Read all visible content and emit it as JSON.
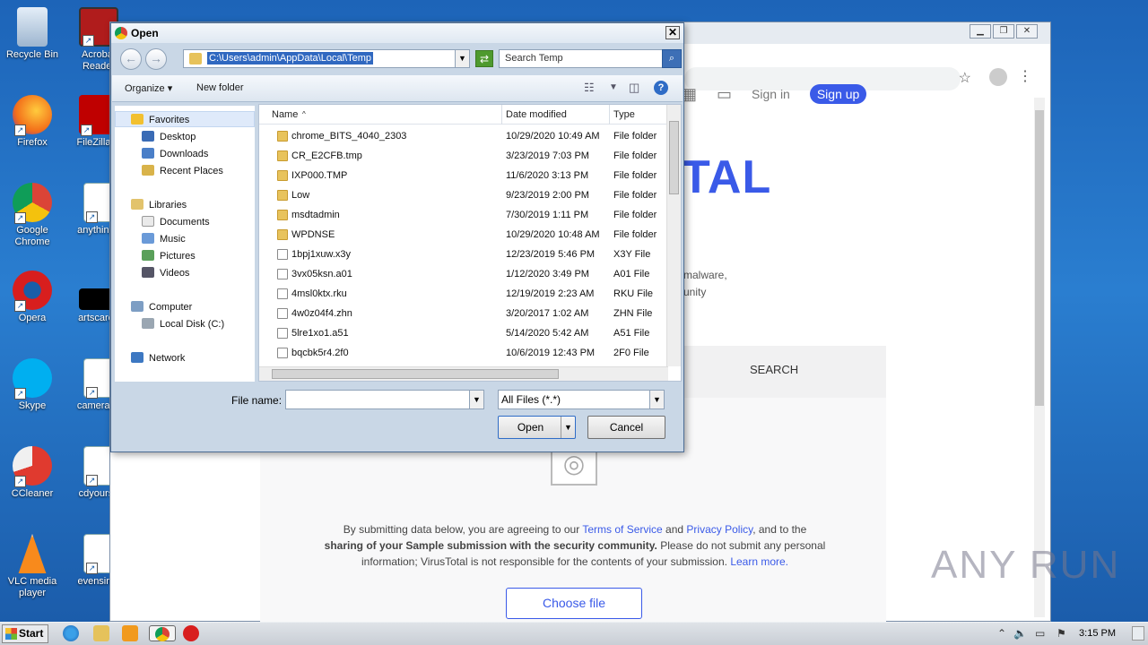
{
  "desktop": {
    "icons": [
      {
        "label": "Recycle Bin"
      },
      {
        "label": "Acrobat Reader"
      },
      {
        "label": "Firefox"
      },
      {
        "label": "FileZilla C"
      },
      {
        "label": "Google Chrome"
      },
      {
        "label": "anythingh"
      },
      {
        "label": "Opera"
      },
      {
        "label": "artscaree"
      },
      {
        "label": "Skype"
      },
      {
        "label": "cameraca"
      },
      {
        "label": "CCleaner"
      },
      {
        "label": "cdyourse"
      },
      {
        "label": "VLC media player"
      },
      {
        "label": "evensimp"
      }
    ]
  },
  "browser": {
    "header": {
      "signin": "Sign in",
      "signup": "Sign up"
    },
    "logo_fragment": "TAL",
    "sub1": "malware,",
    "sub2": "unity",
    "tab_search": "SEARCH",
    "notice": {
      "p1": "By submitting data below, you are agreeing to our ",
      "terms": "Terms of Service",
      "and": " and ",
      "privacy": "Privacy Policy",
      "p2": ", and to the",
      "bold": "sharing of your Sample submission with the security community.",
      "p3": " Please do not submit any personal information; VirusTotal is not responsible for the contents of your submission. ",
      "learn": "Learn more."
    },
    "choose_file": "Choose file"
  },
  "dialog": {
    "title": "Open",
    "address": "C:\\Users\\admin\\AppData\\Local\\Temp",
    "search_placeholder": "Search Temp",
    "organize": "Organize",
    "new_folder": "New folder",
    "nav": {
      "favorites": "Favorites",
      "desktop": "Desktop",
      "downloads": "Downloads",
      "recent": "Recent Places",
      "libraries": "Libraries",
      "documents": "Documents",
      "music": "Music",
      "pictures": "Pictures",
      "videos": "Videos",
      "computer": "Computer",
      "local_disk": "Local Disk (C:)",
      "network": "Network"
    },
    "columns": {
      "name": "Name",
      "date": "Date modified",
      "type": "Type"
    },
    "files": [
      {
        "name": "chrome_BITS_4040_2303",
        "date": "10/29/2020 10:49 AM",
        "type": "File folder",
        "kind": "folder"
      },
      {
        "name": "CR_E2CFB.tmp",
        "date": "3/23/2019 7:03 PM",
        "type": "File folder",
        "kind": "folder"
      },
      {
        "name": "IXP000.TMP",
        "date": "11/6/2020 3:13 PM",
        "type": "File folder",
        "kind": "folder"
      },
      {
        "name": "Low",
        "date": "9/23/2019 2:00 PM",
        "type": "File folder",
        "kind": "folder"
      },
      {
        "name": "msdtadmin",
        "date": "7/30/2019 1:11 PM",
        "type": "File folder",
        "kind": "folder"
      },
      {
        "name": "WPDNSE",
        "date": "10/29/2020 10:48 AM",
        "type": "File folder",
        "kind": "folder"
      },
      {
        "name": "1bpj1xuw.x3y",
        "date": "12/23/2019 5:46 PM",
        "type": "X3Y File",
        "kind": "file"
      },
      {
        "name": "3vx05ksn.a01",
        "date": "1/12/2020 3:49 PM",
        "type": "A01 File",
        "kind": "file"
      },
      {
        "name": "4msl0ktx.rku",
        "date": "12/19/2019 2:23 AM",
        "type": "RKU File",
        "kind": "file"
      },
      {
        "name": "4w0z04f4.zhn",
        "date": "3/20/2017 1:02 AM",
        "type": "ZHN File",
        "kind": "file"
      },
      {
        "name": "5lre1xo1.a51",
        "date": "5/14/2020 5:42 AM",
        "type": "A51 File",
        "kind": "file"
      },
      {
        "name": "bqcbk5r4.2f0",
        "date": "10/6/2019 12:43 PM",
        "type": "2F0 File",
        "kind": "file"
      }
    ],
    "filename_label": "File name:",
    "filename_value": "",
    "filetype": "All Files (*.*)",
    "open": "Open",
    "cancel": "Cancel"
  },
  "taskbar": {
    "start": "Start",
    "clock": "3:15 PM"
  },
  "watermark": "ANY RUN"
}
